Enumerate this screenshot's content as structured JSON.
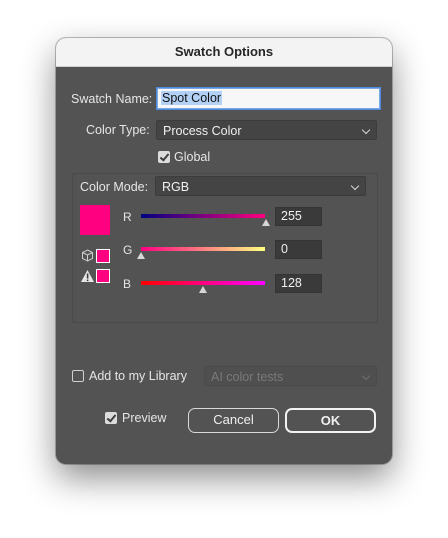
{
  "dialog": {
    "title": "Swatch Options",
    "swatch_name_label": "Swatch Name:",
    "swatch_name_value": "Spot Color",
    "color_type_label": "Color Type:",
    "color_type_value": "Process Color",
    "global_label": "Global",
    "global_checked": true,
    "color_mode_label": "Color Mode:",
    "color_mode_value": "RGB",
    "swatch_color": "#ff0080",
    "channels": [
      {
        "label": "R",
        "value": "255"
      },
      {
        "label": "G",
        "value": "0"
      },
      {
        "label": "B",
        "value": "128"
      }
    ],
    "add_library_label": "Add to my Library",
    "add_library_checked": false,
    "library_value": "AI color tests",
    "preview_label": "Preview",
    "preview_checked": true,
    "cancel_label": "Cancel",
    "ok_label": "OK"
  }
}
